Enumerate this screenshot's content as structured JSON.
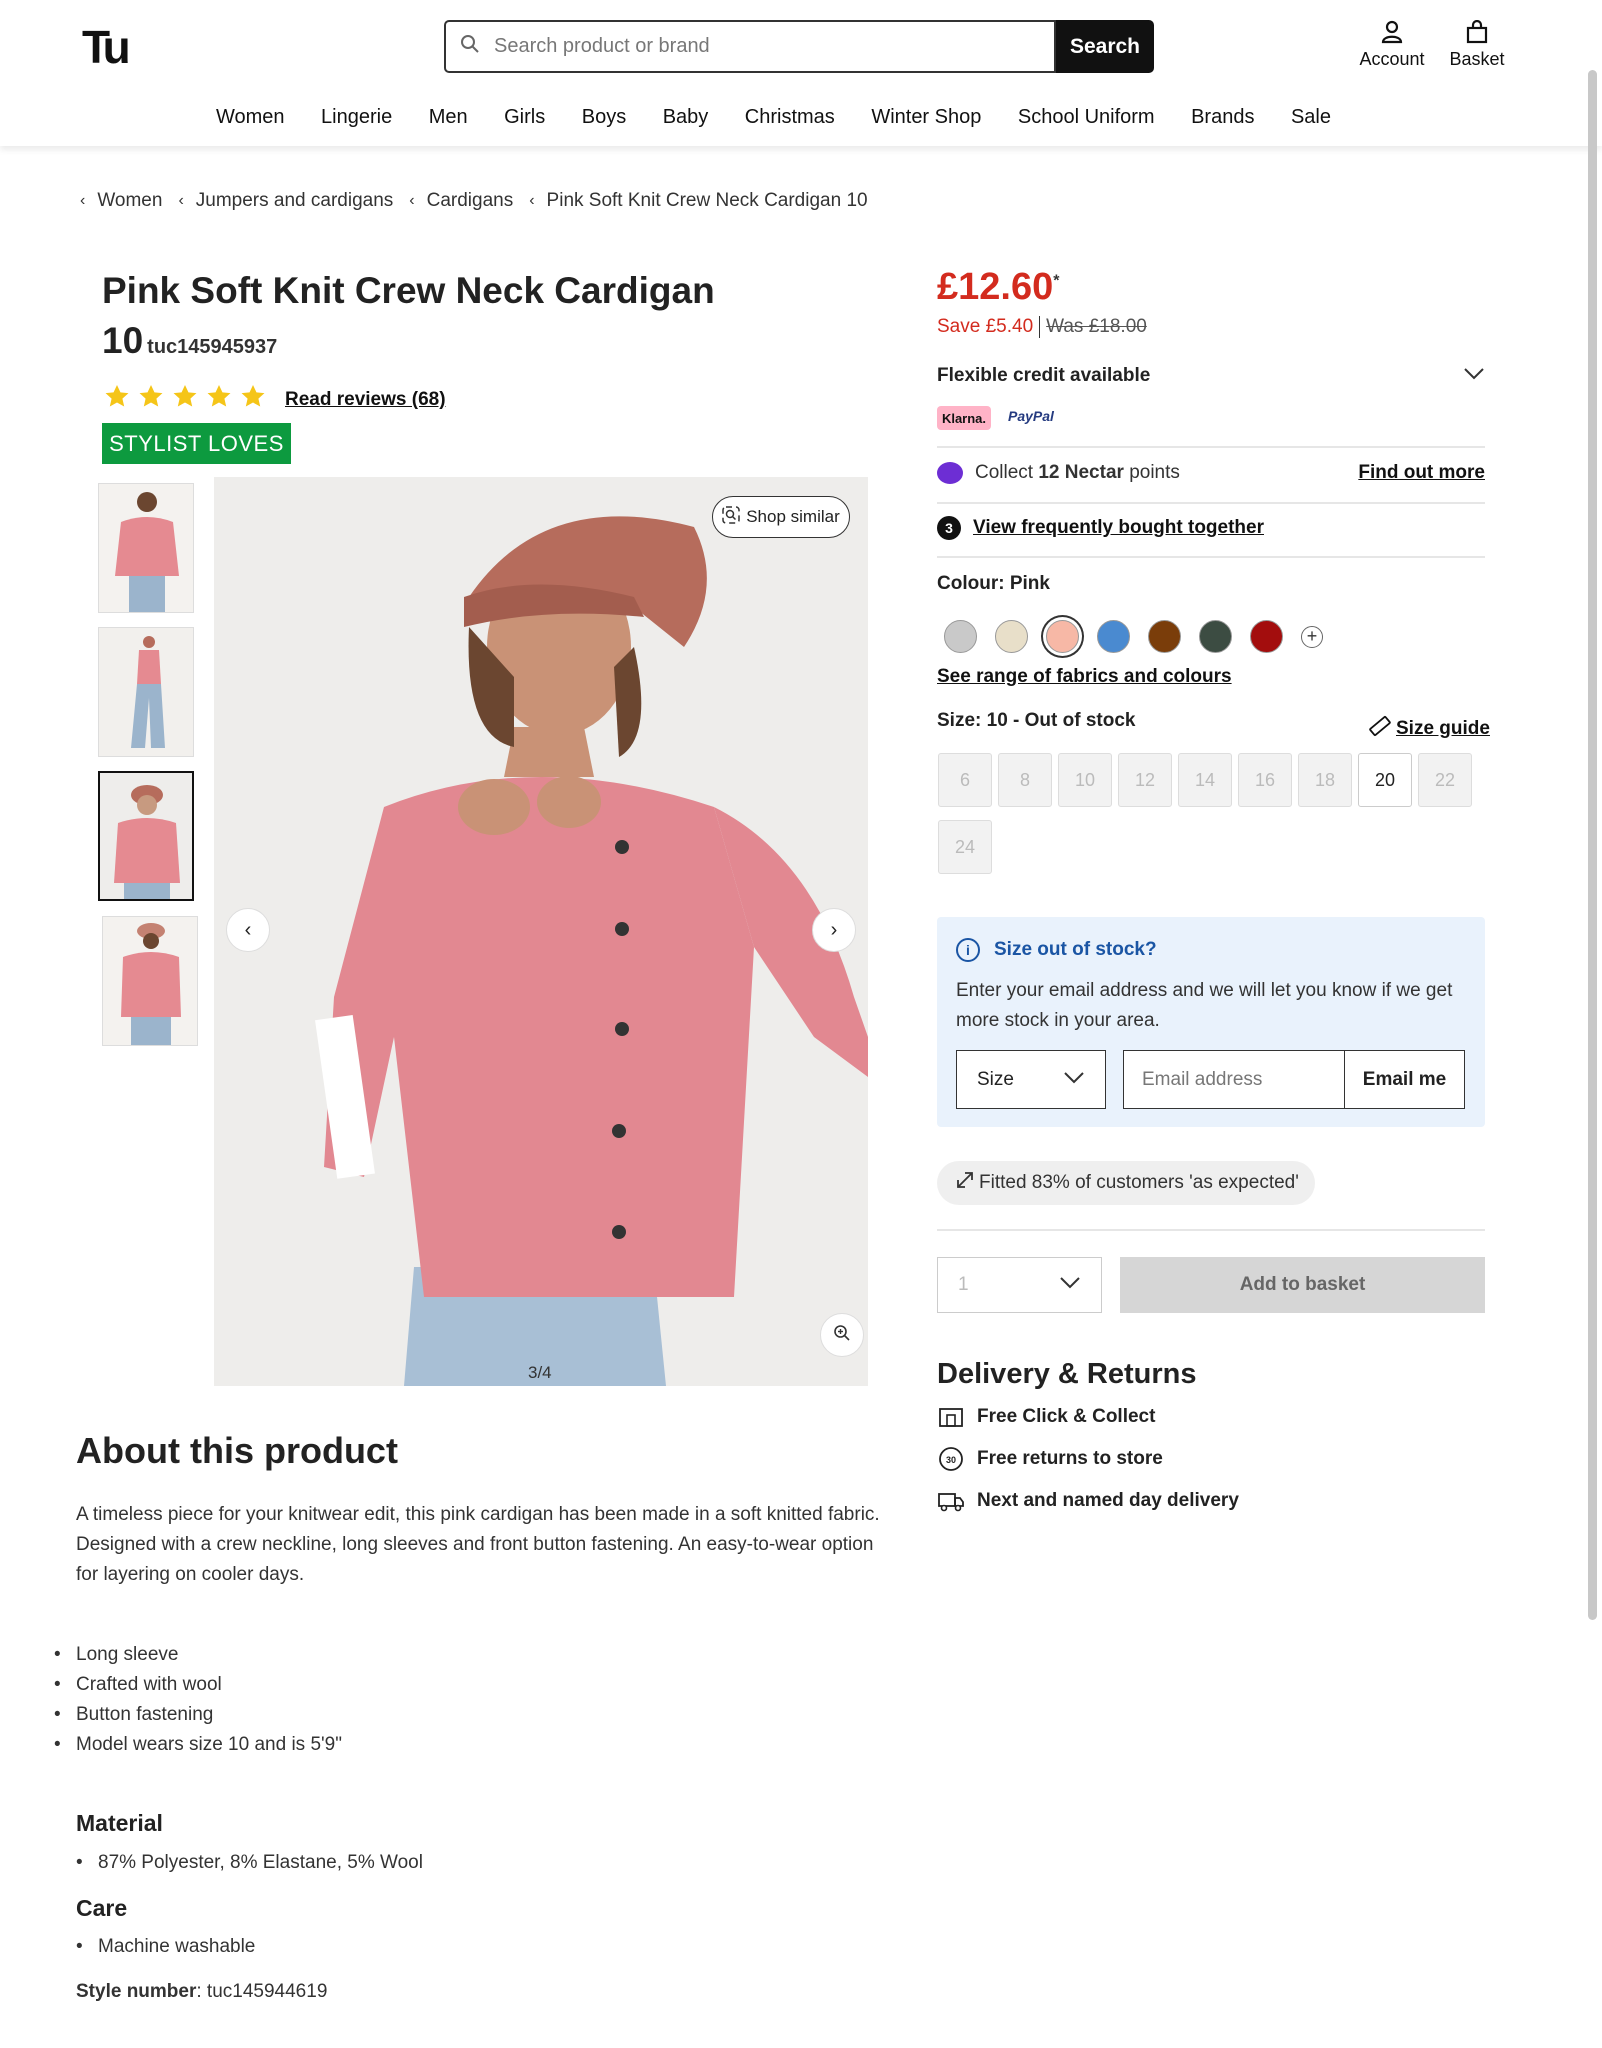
{
  "header": {
    "logo": "Tu",
    "search_placeholder": "Search product or brand",
    "search_button": "Search",
    "account_label": "Account",
    "basket_label": "Basket"
  },
  "nav": [
    "Women",
    "Lingerie",
    "Men",
    "Girls",
    "Boys",
    "Baby",
    "Christmas",
    "Winter Shop",
    "School Uniform",
    "Brands",
    "Sale"
  ],
  "breadcrumb": [
    "Women",
    "Jumpers and cardigans",
    "Cardigans",
    "Pink Soft Knit Crew Neck Cardigan 10"
  ],
  "product": {
    "title": "Pink Soft Knit Crew Neck Cardigan",
    "title_line2": "10",
    "code": "tuc145945937",
    "rating_stars": 5,
    "reviews_link": "Read reviews (68)",
    "badge": "STYLIST LOVES",
    "badge_color": "#0d9a3f",
    "shop_similar": "Shop similar",
    "image_counter": "3/4",
    "active_thumb": 3
  },
  "pricing": {
    "price": "£12.60",
    "asterisk": "*",
    "save": "Save £5.40",
    "was": "Was £18.00",
    "price_color": "#d32b1e",
    "credit_label": "Flexible credit available",
    "klarna": "Klarna.",
    "paypal": "PayPal"
  },
  "nectar": {
    "prefix": "Collect",
    "points": "12 Nectar",
    "suffix": "points",
    "link": "Find out more"
  },
  "frequently": {
    "count": "3",
    "link": "View frequently bought together"
  },
  "colour": {
    "label": "Colour: Pink",
    "swatches": [
      "#c9c9c9",
      "#e8dfc9",
      "#f7b8a6",
      "#4a8ad0",
      "#7a3d0a",
      "#3c4c42",
      "#a30d0d"
    ],
    "selected_index": 2,
    "see_range": "See range of fabrics and colours"
  },
  "size": {
    "label": "Size: 10 - Out of stock",
    "guide": "Size guide",
    "options": [
      "6",
      "8",
      "10",
      "12",
      "14",
      "16",
      "18",
      "20",
      "22",
      "24"
    ],
    "in_stock": [
      "20"
    ]
  },
  "out_of_stock": {
    "title": "Size out of stock?",
    "description": "Enter your email address and we will let you know if we get more stock in your area.",
    "size_select": "Size",
    "email_placeholder": "Email address",
    "button": "Email me"
  },
  "fit": {
    "text": "Fitted 83% of customers 'as expected'"
  },
  "purchase": {
    "quantity": "1",
    "add_to_basket": "Add to basket"
  },
  "delivery": {
    "heading": "Delivery & Returns",
    "items": [
      "Free Click & Collect",
      "Free returns to store",
      "Next and named day delivery"
    ],
    "returns_icon_text": "30"
  },
  "about": {
    "heading": "About this product",
    "description": "A timeless piece for your knitwear edit, this pink cardigan has been made in a soft knitted fabric. Designed with a crew neckline, long sleeves and front button fastening. An easy-to-wear option for layering on cooler days.",
    "bullets": [
      "Long sleeve",
      "Crafted with wool",
      "Button fastening",
      "Model wears size 10 and is 5'9\""
    ],
    "material_heading": "Material",
    "material": [
      "87% Polyester, 8% Elastane, 5% Wool"
    ],
    "care_heading": "Care",
    "care": [
      "Machine washable"
    ],
    "style_number_label": "Style number",
    "style_number": ": tuc145944619"
  }
}
